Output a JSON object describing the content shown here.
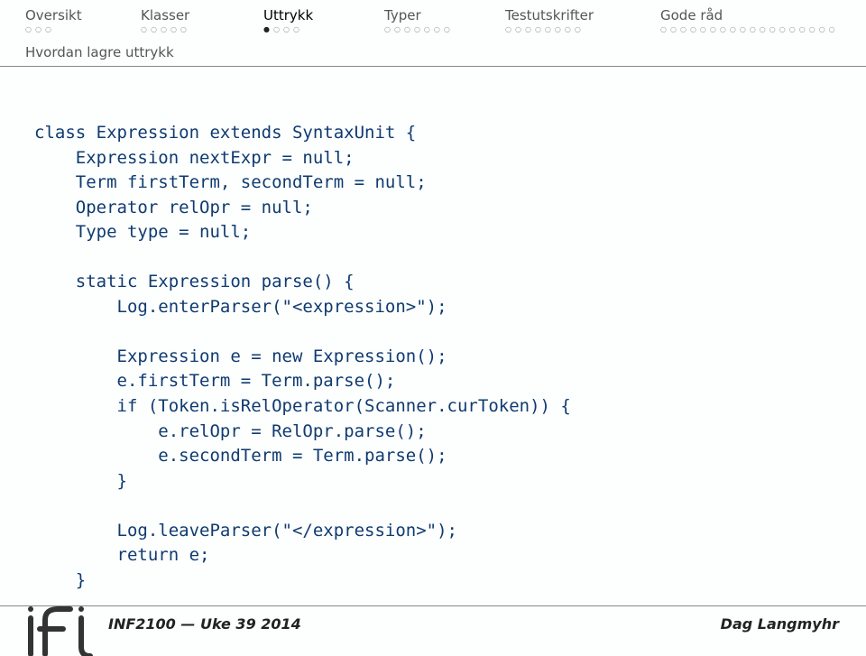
{
  "nav": {
    "items": [
      {
        "label": "Oversikt",
        "active": false,
        "total": 3,
        "current": 0
      },
      {
        "label": "Klasser",
        "active": false,
        "total": 5,
        "current": 0
      },
      {
        "label": "Uttrykk",
        "active": true,
        "total": 4,
        "current": 1
      },
      {
        "label": "Typer",
        "active": false,
        "total": 7,
        "current": 0
      },
      {
        "label": "Testutskrifter",
        "active": false,
        "total": 8,
        "current": 0
      },
      {
        "label": "Gode råd",
        "active": false,
        "total": 18,
        "current": 0
      }
    ]
  },
  "subtitle": "Hvordan lagre uttrykk",
  "code": {
    "l01": "class Expression extends SyntaxUnit {",
    "l02": "    Expression nextExpr = null;",
    "l03": "    Term firstTerm, secondTerm = null;",
    "l04": "    Operator relOpr = null;",
    "l05": "    Type type = null;",
    "l06": "",
    "l07": "    static Expression parse() {",
    "l08": "        Log.enterParser(\"<expression>\");",
    "l09": "",
    "l10": "        Expression e = new Expression();",
    "l11": "        e.firstTerm = Term.parse();",
    "l12": "        if (Token.isRelOperator(Scanner.curToken)) {",
    "l13": "            e.relOpr = RelOpr.parse();",
    "l14": "            e.secondTerm = Term.parse();",
    "l15": "        }",
    "l16": "",
    "l17": "        Log.leaveParser(\"</expression>\");",
    "l18": "        return e;",
    "l19": "    }"
  },
  "footer": {
    "left": "INF2100 — Uke 39 2014",
    "right": "Dag Langmyhr"
  }
}
